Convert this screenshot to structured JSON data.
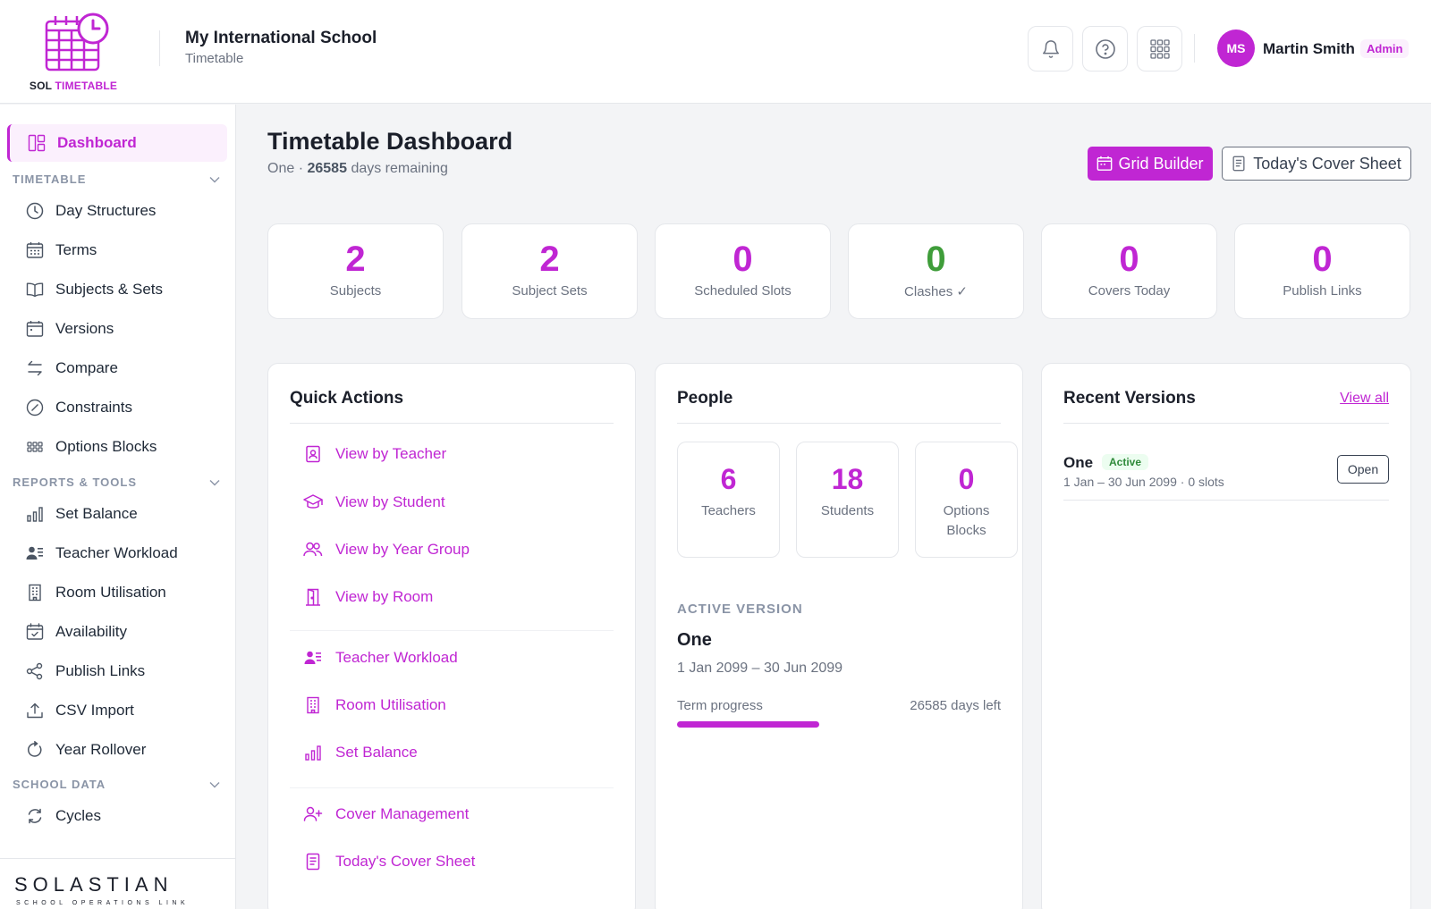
{
  "app": {
    "logo_sol": "SOL",
    "logo_timetable": "TIMETABLE",
    "school_name": "My International School",
    "school_section": "Timetable"
  },
  "header": {
    "icons": [
      "bell-icon",
      "help-icon",
      "apps-grid-icon"
    ],
    "user_initials": "MS",
    "user_name": "Martin Smith",
    "user_role": "Admin"
  },
  "sidebar": {
    "dashboard": "Dashboard",
    "sections": [
      {
        "label": "TIMETABLE",
        "items": [
          "Day Structures",
          "Terms",
          "Subjects & Sets",
          "Versions",
          "Compare",
          "Constraints",
          "Options Blocks"
        ]
      },
      {
        "label": "REPORTS & TOOLS",
        "items": [
          "Set Balance",
          "Teacher Workload",
          "Room Utilisation",
          "Availability",
          "Publish Links",
          "CSV Import",
          "Year Rollover"
        ]
      },
      {
        "label": "SCHOOL DATA",
        "items": [
          "Cycles"
        ]
      }
    ],
    "brand": "SOLASTIAN",
    "brand_tagline": "SCHOOL OPERATIONS LINK"
  },
  "page": {
    "title": "Timetable Dashboard",
    "version_name": "One",
    "separator": "·",
    "days_remaining": "26585",
    "days_remaining_suffix": "days remaining",
    "grid_builder": "Grid Builder",
    "cover_sheet": "Today's Cover Sheet"
  },
  "stats": [
    {
      "value": "2",
      "label": "Subjects"
    },
    {
      "value": "2",
      "label": "Subject Sets"
    },
    {
      "value": "0",
      "label": "Scheduled Slots"
    },
    {
      "value": "0",
      "label": "Clashes ✓"
    },
    {
      "value": "0",
      "label": "Covers Today"
    },
    {
      "value": "0",
      "label": "Publish Links"
    }
  ],
  "quick_actions": {
    "title": "Quick Actions",
    "items": [
      "View by Teacher",
      "View by Student",
      "View by Year Group",
      "View by Room",
      "Teacher Workload",
      "Room Utilisation",
      "Set Balance",
      "Cover Management",
      "Today's Cover Sheet"
    ]
  },
  "people": {
    "title": "People",
    "counts": [
      {
        "value": "6",
        "label": "Teachers"
      },
      {
        "value": "18",
        "label": "Students"
      },
      {
        "value": "0",
        "label": "Options Blocks"
      }
    ],
    "active_version_caption": "ACTIVE VERSION",
    "active_version_name": "One",
    "active_version_dates": "1 Jan 2099 – 30 Jun 2099",
    "term_progress_label": "Term progress",
    "days_left": "26585 days left",
    "term_progress_fraction": 0.44
  },
  "recent_versions": {
    "title": "Recent Versions",
    "view_all": "View all",
    "items": [
      {
        "name": "One",
        "status": "Active",
        "meta": "1 Jan – 30 Jun 2099 · 0 slots",
        "open": "Open"
      }
    ]
  },
  "colors": {
    "accent": "#c026d3",
    "success": "#3f9d3a"
  }
}
